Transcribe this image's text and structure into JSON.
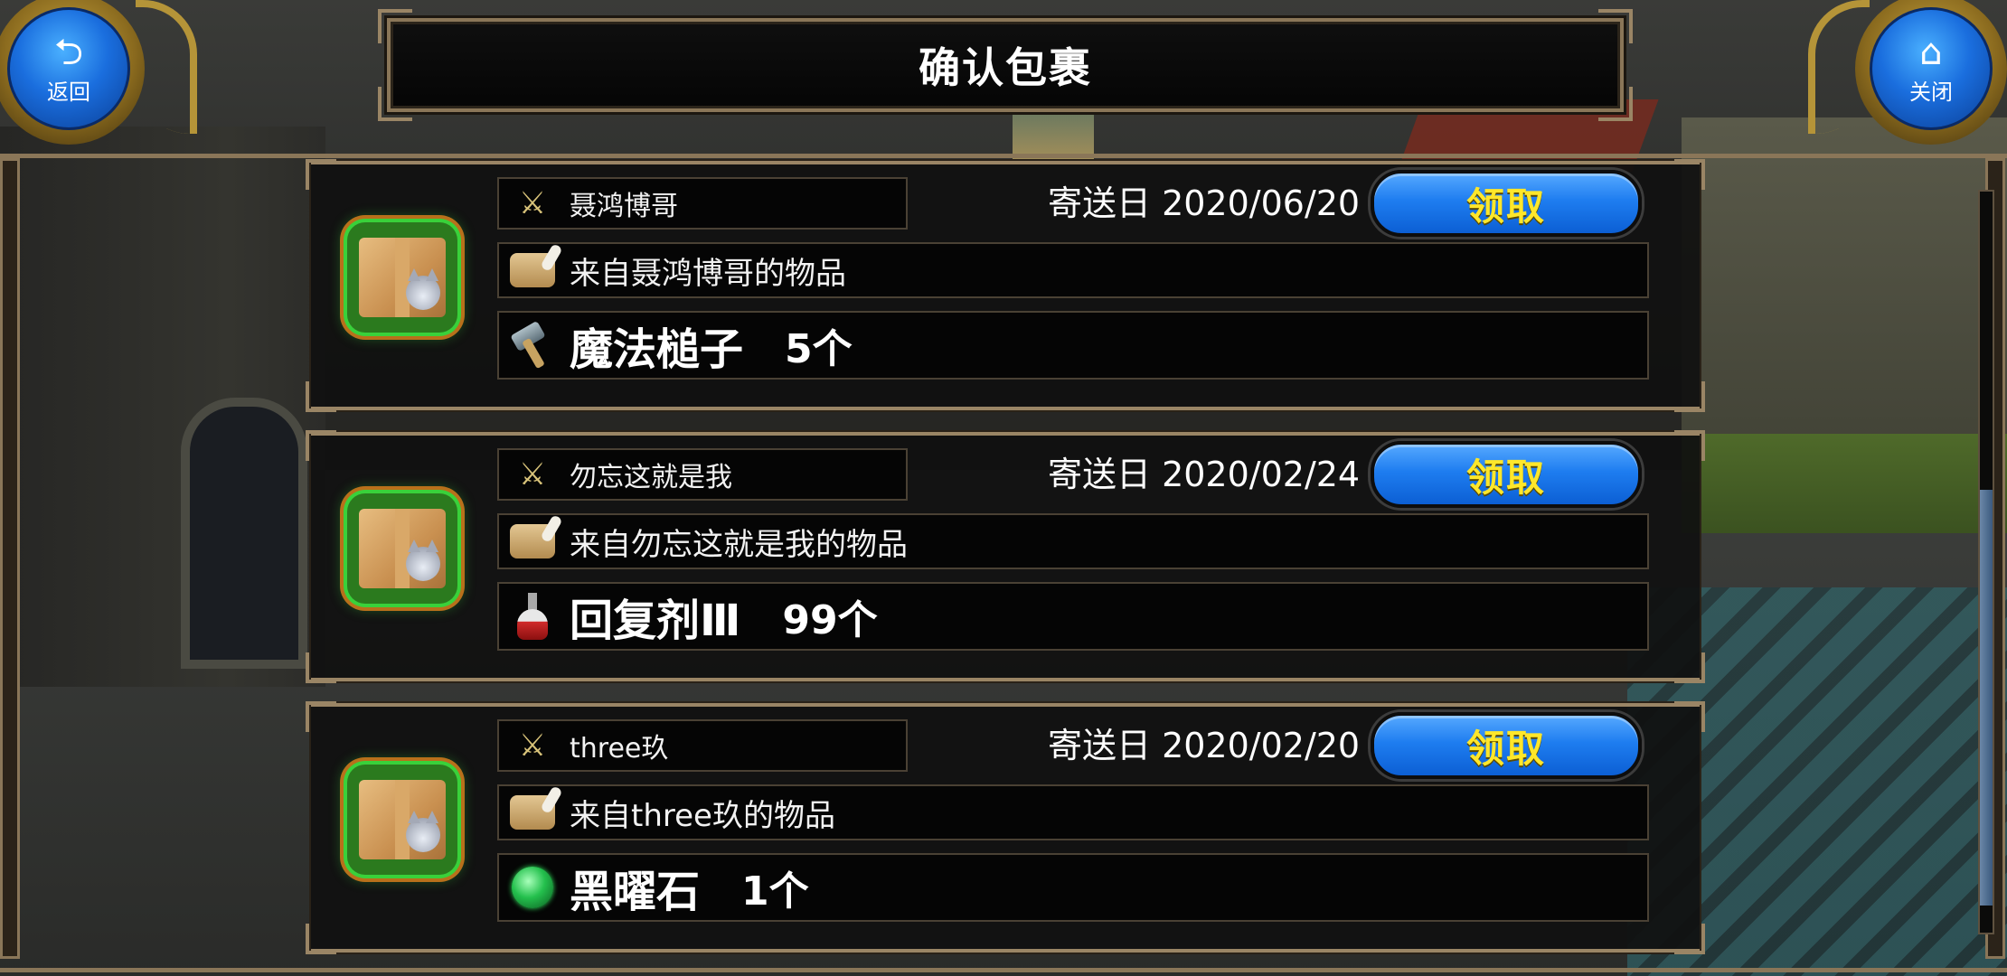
{
  "header": {
    "title": "确认包裹",
    "back_label": "返回",
    "close_label": "关闭"
  },
  "mails": [
    {
      "sender": "聂鸿博哥",
      "date_label": "寄送日 2020/06/20",
      "subject": "来自聂鸿博哥的物品",
      "item_name": "魔法槌子",
      "item_count": "5个",
      "item_icon": "hammer-icon",
      "claim_label": "领取"
    },
    {
      "sender": "勿忘这就是我",
      "date_label": "寄送日 2020/02/24",
      "subject": "来自勿忘这就是我的物品",
      "item_name": "回复剂Ⅲ",
      "item_count": "99个",
      "item_icon": "potion-icon",
      "claim_label": "领取"
    },
    {
      "sender": "three玖",
      "date_label": "寄送日 2020/02/20",
      "subject": "来自three玖的物品",
      "item_name": "黑曜石",
      "item_count": "1个",
      "item_icon": "gem-icon",
      "claim_label": "领取"
    }
  ],
  "colors": {
    "claim_button": "#1e7df0",
    "claim_text": "#ffe72a",
    "frame_gold": "#9a8565",
    "package_glow": "#39d13a"
  }
}
